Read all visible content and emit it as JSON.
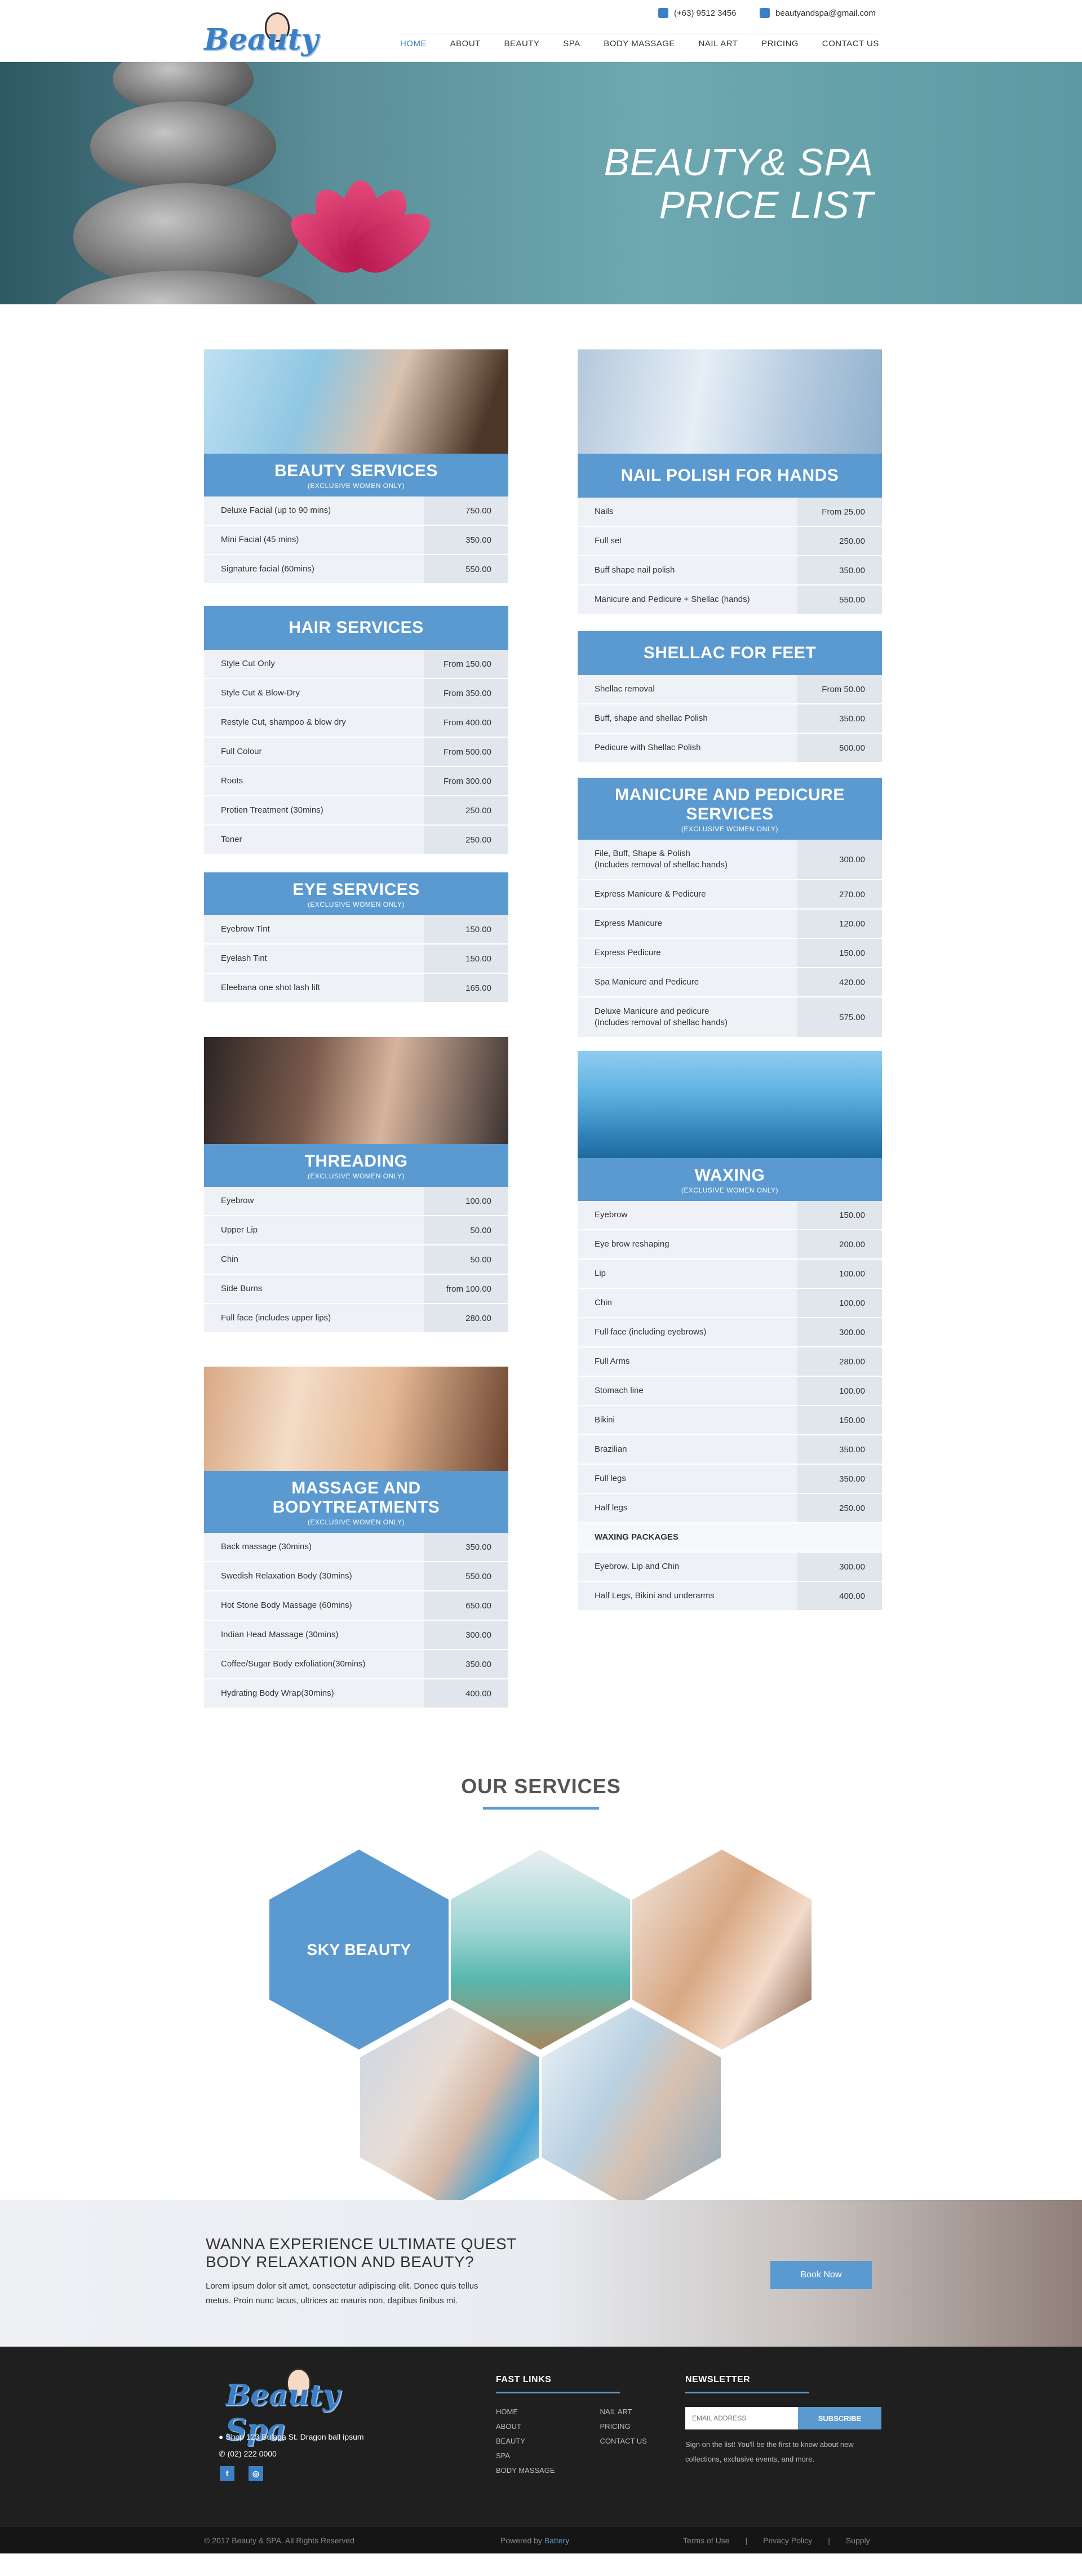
{
  "header": {
    "logo_text": "Beauty Spa",
    "phone": "(+63) 9512 3456",
    "email": "beautyandspa@gmail.com",
    "nav": [
      "HOME",
      "ABOUT",
      "BEAUTY",
      "SPA",
      "BODY MASSAGE",
      "NAIL ART",
      "PRICING",
      "CONTACT US"
    ]
  },
  "hero": {
    "line1": "BEAUTY& SPA",
    "line2": "PRICE LIST"
  },
  "cards": {
    "beauty": {
      "title": "BEAUTY SERVICES",
      "sub": "(EXCLUSIVE WOMEN ONLY)",
      "rows": [
        {
          "n": "Deluxe Facial (up to 90 mins)",
          "p": "750.00"
        },
        {
          "n": "Mini Facial (45 mins)",
          "p": "350.00"
        },
        {
          "n": "Signature facial (60mins)",
          "p": "550.00"
        }
      ]
    },
    "hair": {
      "title": "HAIR SERVICES",
      "rows": [
        {
          "n": "Style Cut Only",
          "p": "From 150.00"
        },
        {
          "n": "Style Cut & Blow-Dry",
          "p": "From 350.00"
        },
        {
          "n": "Restyle Cut, shampoo & blow dry",
          "p": "From 400.00"
        },
        {
          "n": "Full Colour",
          "p": "From 500.00"
        },
        {
          "n": "Roots",
          "p": "From 300.00"
        },
        {
          "n": "Protien Treatment (30mins)",
          "p": "250.00"
        },
        {
          "n": "Toner",
          "p": "250.00"
        }
      ]
    },
    "eye": {
      "title": "EYE SERVICES",
      "sub": "(EXCLUSIVE WOMEN ONLY)",
      "rows": [
        {
          "n": "Eyebrow Tint",
          "p": "150.00"
        },
        {
          "n": "Eyelash Tint",
          "p": "150.00"
        },
        {
          "n": "Eleebana one shot lash lift",
          "p": "165.00"
        }
      ]
    },
    "threading": {
      "title": "THREADING",
      "sub": "(EXCLUSIVE WOMEN ONLY)",
      "rows": [
        {
          "n": "Eyebrow",
          "p": "100.00"
        },
        {
          "n": "Upper Lip",
          "p": "50.00"
        },
        {
          "n": "Chin",
          "p": "50.00"
        },
        {
          "n": "Side Burns",
          "p": "from 100.00"
        },
        {
          "n": "Full face (includes upper lips)",
          "p": "280.00"
        }
      ]
    },
    "massage": {
      "title": "MASSAGE AND BODYTREATMENTS",
      "sub": "(EXCLUSIVE WOMEN ONLY)",
      "rows": [
        {
          "n": "Back massage (30mins)",
          "p": "350.00"
        },
        {
          "n": "Swedish Relaxation Body (30mins)",
          "p": "550.00"
        },
        {
          "n": "Hot Stone Body Massage (60mins)",
          "p": "650.00"
        },
        {
          "n": "Indian Head Massage (30mins)",
          "p": "300.00"
        },
        {
          "n": "Coffee/Sugar Body exfoliation(30mins)",
          "p": "350.00"
        },
        {
          "n": "Hydrating Body Wrap(30mins)",
          "p": "400.00"
        }
      ]
    },
    "nails": {
      "title": "NAIL POLISH FOR HANDS",
      "rows": [
        {
          "n": "Nails",
          "p": "From 25.00"
        },
        {
          "n": "Full set",
          "p": "250.00"
        },
        {
          "n": "Buff shape  nail polish",
          "p": "350.00"
        },
        {
          "n": "Manicure and Pedicure + Shellac (hands)",
          "p": "550.00"
        }
      ]
    },
    "shellac": {
      "title": "SHELLAC FOR FEET",
      "rows": [
        {
          "n": "Shellac removal",
          "p": "From 50.00"
        },
        {
          "n": "Buff, shape and shellac Polish",
          "p": "350.00"
        },
        {
          "n": "Pedicure with Shellac Polish",
          "p": "500.00"
        }
      ]
    },
    "manicure": {
      "title": "MANICURE AND PEDICURE SERVICES",
      "sub": "(EXCLUSIVE WOMEN ONLY)",
      "rows": [
        {
          "n": "File, Buff, Shape & Polish\n(Includes removal of shellac hands)",
          "p": "300.00"
        },
        {
          "n": "Express Manicure & Pedicure",
          "p": "270.00"
        },
        {
          "n": "Express Manicure",
          "p": "120.00"
        },
        {
          "n": "Express Pedicure",
          "p": "150.00"
        },
        {
          "n": "Spa Manicure and Pedicure",
          "p": "420.00"
        },
        {
          "n": "Deluxe Manicure and pedicure\n(Includes removal of shellac hands)",
          "p": "575.00"
        }
      ]
    },
    "waxing": {
      "title": "WAXING",
      "sub": "(EXCLUSIVE WOMEN ONLY)",
      "rows": [
        {
          "n": "Eyebrow",
          "p": "150.00"
        },
        {
          "n": "Eye brow reshaping",
          "p": "200.00"
        },
        {
          "n": "Lip",
          "p": "100.00"
        },
        {
          "n": "Chin",
          "p": "100.00"
        },
        {
          "n": "Full face (including eyebrows)",
          "p": "300.00"
        },
        {
          "n": "Full Arms",
          "p": "280.00"
        },
        {
          "n": "Stomach line",
          "p": "100.00"
        },
        {
          "n": "Bikini",
          "p": "150.00"
        },
        {
          "n": "Brazilian",
          "p": "350.00"
        },
        {
          "n": "Full legs",
          "p": "350.00"
        },
        {
          "n": "Half legs",
          "p": "250.00"
        }
      ],
      "package_label": "WAXING PACKAGES",
      "packages": [
        {
          "n": "Eyebrow, Lip and Chin",
          "p": "300.00"
        },
        {
          "n": "Half Legs, Bikini and underarms",
          "p": "400.00"
        }
      ]
    }
  },
  "services": {
    "title": "OUR SERVICES",
    "featured": "SKY BEAUTY"
  },
  "cta": {
    "line1": "WANNA EXPERIENCE ULTIMATE QUEST",
    "line2": "BODY RELAXATION AND BEAUTY?",
    "text": "Lorem ipsum dolor sit amet, consectetur adipiscing elit. Donec quis tellus metus. Proin nunc lacus, ultrices ac mauris non, dapibus finibus mi.",
    "button": "Book Now"
  },
  "footer": {
    "address": "Shop 123 Bulaga St. Dragon ball ipsum",
    "phone": "(02) 222 0000",
    "social": [
      "f",
      "◎"
    ],
    "links_title": "FAST LINKS",
    "links_col1": [
      "HOME",
      "ABOUT",
      "BEAUTY",
      "SPA",
      "BODY MASSAGE"
    ],
    "links_col2": [
      "NAIL ART",
      "PRICING",
      "CONTACT US"
    ],
    "news_title": "NEWSLETTER",
    "email_placeholder": "EMAIL ADDRESS",
    "subscribe": "SUBSCRIBE",
    "news_text": "Sign on the list! You'll be the first to know about new collections, exclusive events, and more."
  },
  "bottom": {
    "copyright": "© 2017 Beauty & SPA. All Rights Reserved",
    "powered_prefix": "Powered by ",
    "powered_brand": "Battery",
    "links": [
      "Terms of Use",
      "|",
      "Privacy Policy",
      "|",
      "Supply"
    ]
  },
  "colors": {
    "accent": "#5b9ad0",
    "brand": "#3d7fc4",
    "footer": "#1f1f1f"
  }
}
